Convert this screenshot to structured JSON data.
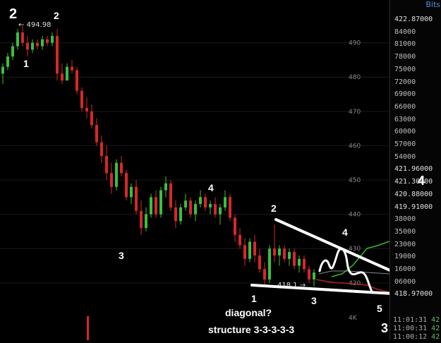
{
  "brand": "Bits",
  "chart_data": {
    "type": "candlestick",
    "y_axis_ticks": [
      490,
      480,
      470,
      460,
      450,
      440,
      430,
      420
    ],
    "ylim": [
      414,
      500
    ],
    "volume_axis_tick": "4K",
    "max_label": "← 494.98",
    "low_label": "418.1 →",
    "candles": [
      {
        "o": 481,
        "h": 484,
        "l": 478,
        "c": 483
      },
      {
        "o": 483,
        "h": 487,
        "l": 482,
        "c": 486
      },
      {
        "o": 486,
        "h": 490,
        "l": 485,
        "c": 489
      },
      {
        "o": 489,
        "h": 494,
        "l": 488,
        "c": 493
      },
      {
        "o": 493,
        "h": 495,
        "l": 489,
        "c": 490
      },
      {
        "o": 490,
        "h": 492,
        "l": 486,
        "c": 488
      },
      {
        "o": 488,
        "h": 491,
        "l": 487,
        "c": 490
      },
      {
        "o": 490,
        "h": 491,
        "l": 488,
        "c": 489
      },
      {
        "o": 489,
        "h": 492,
        "l": 488,
        "c": 491
      },
      {
        "o": 491,
        "h": 492,
        "l": 489,
        "c": 490
      },
      {
        "o": 490,
        "h": 493,
        "l": 489,
        "c": 492
      },
      {
        "o": 492,
        "h": 494,
        "l": 479,
        "c": 481
      },
      {
        "o": 481,
        "h": 484,
        "l": 478,
        "c": 479
      },
      {
        "o": 479,
        "h": 484,
        "l": 479,
        "c": 483
      },
      {
        "o": 483,
        "h": 485,
        "l": 481,
        "c": 482
      },
      {
        "o": 482,
        "h": 483,
        "l": 475,
        "c": 476
      },
      {
        "o": 476,
        "h": 477,
        "l": 470,
        "c": 471
      },
      {
        "o": 471,
        "h": 474,
        "l": 468,
        "c": 470
      },
      {
        "o": 470,
        "h": 472,
        "l": 465,
        "c": 466
      },
      {
        "o": 466,
        "h": 468,
        "l": 460,
        "c": 461
      },
      {
        "o": 461,
        "h": 463,
        "l": 455,
        "c": 457
      },
      {
        "o": 457,
        "h": 460,
        "l": 450,
        "c": 452
      },
      {
        "o": 452,
        "h": 455,
        "l": 446,
        "c": 448
      },
      {
        "o": 448,
        "h": 456,
        "l": 447,
        "c": 455
      },
      {
        "o": 455,
        "h": 457,
        "l": 451,
        "c": 452
      },
      {
        "o": 452,
        "h": 453,
        "l": 444,
        "c": 445
      },
      {
        "o": 445,
        "h": 449,
        "l": 443,
        "c": 448
      },
      {
        "o": 448,
        "h": 450,
        "l": 440,
        "c": 441
      },
      {
        "o": 441,
        "h": 444,
        "l": 434,
        "c": 436
      },
      {
        "o": 436,
        "h": 442,
        "l": 435,
        "c": 440
      },
      {
        "o": 440,
        "h": 446,
        "l": 439,
        "c": 445
      },
      {
        "o": 445,
        "h": 447,
        "l": 439,
        "c": 440
      },
      {
        "o": 440,
        "h": 448,
        "l": 439,
        "c": 447
      },
      {
        "o": 447,
        "h": 451,
        "l": 445,
        "c": 449
      },
      {
        "o": 449,
        "h": 450,
        "l": 441,
        "c": 442
      },
      {
        "o": 442,
        "h": 444,
        "l": 436,
        "c": 438
      },
      {
        "o": 438,
        "h": 443,
        "l": 437,
        "c": 442
      },
      {
        "o": 442,
        "h": 446,
        "l": 441,
        "c": 444
      },
      {
        "o": 444,
        "h": 445,
        "l": 439,
        "c": 440
      },
      {
        "o": 440,
        "h": 444,
        "l": 438,
        "c": 443
      },
      {
        "o": 443,
        "h": 447,
        "l": 442,
        "c": 445
      },
      {
        "o": 445,
        "h": 446,
        "l": 441,
        "c": 442
      },
      {
        "o": 442,
        "h": 444,
        "l": 440,
        "c": 443
      },
      {
        "o": 443,
        "h": 445,
        "l": 439,
        "c": 440
      },
      {
        "o": 440,
        "h": 443,
        "l": 437,
        "c": 442
      },
      {
        "o": 442,
        "h": 447,
        "l": 441,
        "c": 445
      },
      {
        "o": 445,
        "h": 446,
        "l": 438,
        "c": 439
      },
      {
        "o": 439,
        "h": 440,
        "l": 432,
        "c": 434
      },
      {
        "o": 434,
        "h": 436,
        "l": 430,
        "c": 431
      },
      {
        "o": 431,
        "h": 433,
        "l": 425,
        "c": 427
      },
      {
        "o": 427,
        "h": 433,
        "l": 426,
        "c": 432
      },
      {
        "o": 432,
        "h": 434,
        "l": 426,
        "c": 428
      },
      {
        "o": 428,
        "h": 430,
        "l": 423,
        "c": 424
      },
      {
        "o": 424,
        "h": 426,
        "l": 419,
        "c": 421
      },
      {
        "o": 421,
        "h": 431,
        "l": 420,
        "c": 430
      },
      {
        "o": 430,
        "h": 437,
        "l": 426,
        "c": 428
      },
      {
        "o": 428,
        "h": 431,
        "l": 425,
        "c": 430
      },
      {
        "o": 430,
        "h": 431,
        "l": 426,
        "c": 427
      },
      {
        "o": 427,
        "h": 430,
        "l": 425,
        "c": 429
      },
      {
        "o": 429,
        "h": 430,
        "l": 424,
        "c": 425
      },
      {
        "o": 425,
        "h": 428,
        "l": 423,
        "c": 427
      },
      {
        "o": 427,
        "h": 428,
        "l": 423,
        "c": 424
      },
      {
        "o": 424,
        "h": 425,
        "l": 420,
        "c": 421
      },
      {
        "o": 421,
        "h": 424,
        "l": 419,
        "c": 423
      }
    ]
  },
  "price_labels_right": [
    {
      "text": "422.87000",
      "big": true
    },
    {
      "text": "84000"
    },
    {
      "text": "81000"
    },
    {
      "text": "78000"
    },
    {
      "text": "75000"
    },
    {
      "text": "72000"
    },
    {
      "text": "69000"
    },
    {
      "text": "66000"
    },
    {
      "text": "63000"
    },
    {
      "text": "60000"
    },
    {
      "text": "57000"
    },
    {
      "text": "54000"
    },
    {
      "text": "421.96000",
      "big": true
    },
    {
      "text": "421.30000",
      "big": true
    },
    {
      "text": "420.88000",
      "big": true
    },
    {
      "text": "419.91000",
      "big": true
    },
    {
      "text": "38000"
    },
    {
      "text": "35000"
    },
    {
      "text": "23000"
    },
    {
      "text": "19000"
    },
    {
      "text": "16000"
    },
    {
      "text": "06000"
    },
    {
      "text": "418.97000",
      "big": true
    }
  ],
  "times": [
    {
      "t": "11:01:31",
      "v": "42"
    },
    {
      "t": "11:00:31",
      "v": "42"
    },
    {
      "t": "11:00:12",
      "v": "42"
    }
  ],
  "annotations": {
    "wave_2_big": "2",
    "wave_2_top": "2",
    "wave_1_top": "1",
    "wave_3_mid": "3",
    "wave_4_mid": "4",
    "wave_2_right": "2",
    "wave_4_right": "4",
    "wave_1_bottom": "1",
    "wave_3_bottom": "3",
    "wave_5": "5",
    "wave_3_corner": "3",
    "wave_4_target": "4",
    "diagonal_text": "diagonal?",
    "structure_text": "structure 3-3-3-3-3"
  },
  "colors": {
    "up": "#3cbf3c",
    "down": "#d62828",
    "annotation": "#ffffff",
    "grid": "#1a1a1a"
  }
}
